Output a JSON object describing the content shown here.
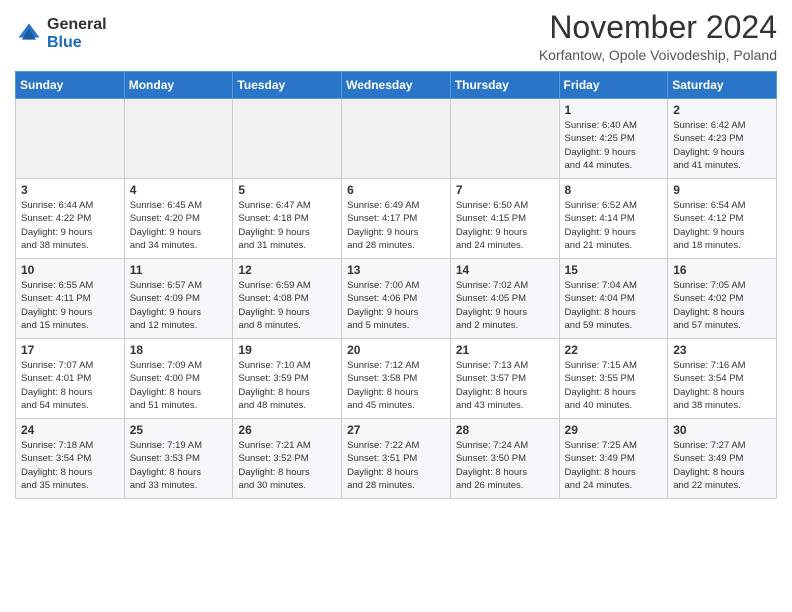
{
  "header": {
    "logo_general": "General",
    "logo_blue": "Blue",
    "month_title": "November 2024",
    "subtitle": "Korfantow, Opole Voivodeship, Poland"
  },
  "weekdays": [
    "Sunday",
    "Monday",
    "Tuesday",
    "Wednesday",
    "Thursday",
    "Friday",
    "Saturday"
  ],
  "weeks": [
    [
      {
        "day": "",
        "info": ""
      },
      {
        "day": "",
        "info": ""
      },
      {
        "day": "",
        "info": ""
      },
      {
        "day": "",
        "info": ""
      },
      {
        "day": "",
        "info": ""
      },
      {
        "day": "1",
        "info": "Sunrise: 6:40 AM\nSunset: 4:25 PM\nDaylight: 9 hours\nand 44 minutes."
      },
      {
        "day": "2",
        "info": "Sunrise: 6:42 AM\nSunset: 4:23 PM\nDaylight: 9 hours\nand 41 minutes."
      }
    ],
    [
      {
        "day": "3",
        "info": "Sunrise: 6:44 AM\nSunset: 4:22 PM\nDaylight: 9 hours\nand 38 minutes."
      },
      {
        "day": "4",
        "info": "Sunrise: 6:45 AM\nSunset: 4:20 PM\nDaylight: 9 hours\nand 34 minutes."
      },
      {
        "day": "5",
        "info": "Sunrise: 6:47 AM\nSunset: 4:18 PM\nDaylight: 9 hours\nand 31 minutes."
      },
      {
        "day": "6",
        "info": "Sunrise: 6:49 AM\nSunset: 4:17 PM\nDaylight: 9 hours\nand 28 minutes."
      },
      {
        "day": "7",
        "info": "Sunrise: 6:50 AM\nSunset: 4:15 PM\nDaylight: 9 hours\nand 24 minutes."
      },
      {
        "day": "8",
        "info": "Sunrise: 6:52 AM\nSunset: 4:14 PM\nDaylight: 9 hours\nand 21 minutes."
      },
      {
        "day": "9",
        "info": "Sunrise: 6:54 AM\nSunset: 4:12 PM\nDaylight: 9 hours\nand 18 minutes."
      }
    ],
    [
      {
        "day": "10",
        "info": "Sunrise: 6:55 AM\nSunset: 4:11 PM\nDaylight: 9 hours\nand 15 minutes."
      },
      {
        "day": "11",
        "info": "Sunrise: 6:57 AM\nSunset: 4:09 PM\nDaylight: 9 hours\nand 12 minutes."
      },
      {
        "day": "12",
        "info": "Sunrise: 6:59 AM\nSunset: 4:08 PM\nDaylight: 9 hours\nand 8 minutes."
      },
      {
        "day": "13",
        "info": "Sunrise: 7:00 AM\nSunset: 4:06 PM\nDaylight: 9 hours\nand 5 minutes."
      },
      {
        "day": "14",
        "info": "Sunrise: 7:02 AM\nSunset: 4:05 PM\nDaylight: 9 hours\nand 2 minutes."
      },
      {
        "day": "15",
        "info": "Sunrise: 7:04 AM\nSunset: 4:04 PM\nDaylight: 8 hours\nand 59 minutes."
      },
      {
        "day": "16",
        "info": "Sunrise: 7:05 AM\nSunset: 4:02 PM\nDaylight: 8 hours\nand 57 minutes."
      }
    ],
    [
      {
        "day": "17",
        "info": "Sunrise: 7:07 AM\nSunset: 4:01 PM\nDaylight: 8 hours\nand 54 minutes."
      },
      {
        "day": "18",
        "info": "Sunrise: 7:09 AM\nSunset: 4:00 PM\nDaylight: 8 hours\nand 51 minutes."
      },
      {
        "day": "19",
        "info": "Sunrise: 7:10 AM\nSunset: 3:59 PM\nDaylight: 8 hours\nand 48 minutes."
      },
      {
        "day": "20",
        "info": "Sunrise: 7:12 AM\nSunset: 3:58 PM\nDaylight: 8 hours\nand 45 minutes."
      },
      {
        "day": "21",
        "info": "Sunrise: 7:13 AM\nSunset: 3:57 PM\nDaylight: 8 hours\nand 43 minutes."
      },
      {
        "day": "22",
        "info": "Sunrise: 7:15 AM\nSunset: 3:55 PM\nDaylight: 8 hours\nand 40 minutes."
      },
      {
        "day": "23",
        "info": "Sunrise: 7:16 AM\nSunset: 3:54 PM\nDaylight: 8 hours\nand 38 minutes."
      }
    ],
    [
      {
        "day": "24",
        "info": "Sunrise: 7:18 AM\nSunset: 3:54 PM\nDaylight: 8 hours\nand 35 minutes."
      },
      {
        "day": "25",
        "info": "Sunrise: 7:19 AM\nSunset: 3:53 PM\nDaylight: 8 hours\nand 33 minutes."
      },
      {
        "day": "26",
        "info": "Sunrise: 7:21 AM\nSunset: 3:52 PM\nDaylight: 8 hours\nand 30 minutes."
      },
      {
        "day": "27",
        "info": "Sunrise: 7:22 AM\nSunset: 3:51 PM\nDaylight: 8 hours\nand 28 minutes."
      },
      {
        "day": "28",
        "info": "Sunrise: 7:24 AM\nSunset: 3:50 PM\nDaylight: 8 hours\nand 26 minutes."
      },
      {
        "day": "29",
        "info": "Sunrise: 7:25 AM\nSunset: 3:49 PM\nDaylight: 8 hours\nand 24 minutes."
      },
      {
        "day": "30",
        "info": "Sunrise: 7:27 AM\nSunset: 3:49 PM\nDaylight: 8 hours\nand 22 minutes."
      }
    ]
  ]
}
